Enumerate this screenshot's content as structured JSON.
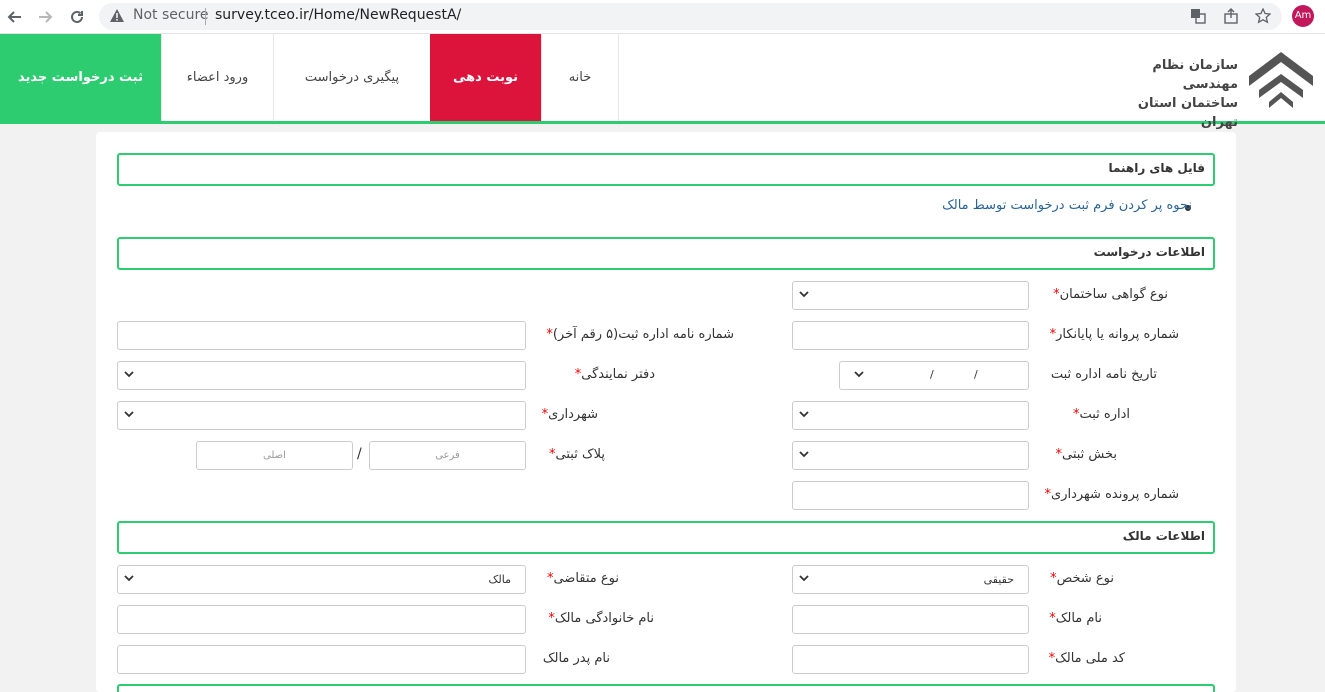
{
  "browser": {
    "not_secure": "Not secure",
    "url": "survey.tceo.ir/Home/NewRequestA/",
    "avatar_initials": "Am"
  },
  "header": {
    "new_request": "ثبت درخواست جدید",
    "menu": {
      "login": "ورود اعضاء",
      "tracking": "پیگیری درخواست",
      "appointment": "نوبت دهی",
      "home": "خانه"
    },
    "logo_line1": "سازمان نظام مهندسی",
    "logo_line2": "ساختمان استان تهران",
    "colors": {
      "accent_green": "#2ecc71",
      "active_red": "#dc143c"
    }
  },
  "guides": {
    "title": "فایل های راهنما",
    "link": "نحوه پر کردن فرم ثبت درخواست توسط مالک"
  },
  "request_info": {
    "title": "اطلاعات درخواست",
    "certificate_type": "نوع گواهی ساختمان",
    "permit_number": "شماره پروانه یا پایانکار",
    "registry_letter_number": "شماره نامه اداره ثبت(۵ رقم آخر)",
    "registry_letter_date": "تاریخ نامه اداره ثبت",
    "date_sep": "/",
    "agency_office": "دفتر نمایندگی",
    "registry_office": "اداره ثبت",
    "municipality": "شهرداری",
    "registry_section": "بخش ثبتی",
    "plot_number": "پلاک ثبتی",
    "sub_placeholder": "فرعی",
    "main_placeholder": "اصلی",
    "plot_sep": "/",
    "municipality_file": "شماره پرونده شهرداری"
  },
  "owner_info": {
    "title": "اطلاعات مالک",
    "person_type": "نوع شخص",
    "person_type_value": "حقیقی",
    "applicant_type": "نوع متقاضی",
    "applicant_type_value": "مالک",
    "owner_name": "نام مالک",
    "owner_family": "نام خانوادگی مالک",
    "national_code": "کد ملی مالک",
    "father_name": "نام پدر مالک"
  },
  "required_mark": "*"
}
